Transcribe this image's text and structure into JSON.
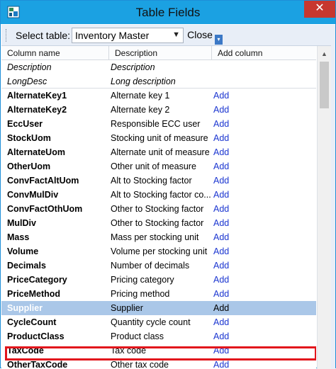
{
  "window": {
    "title": "Table Fields",
    "close_glyph": "✕",
    "app_icon": "table-icon"
  },
  "toolbar": {
    "select_label": "Select table:",
    "table_value": "Inventory Master",
    "close_label": "Close"
  },
  "grid": {
    "headers": [
      "Column name",
      "Description",
      "Add column"
    ],
    "rows": [
      {
        "name": "Description",
        "description": "Description",
        "add": "",
        "style": "italic"
      },
      {
        "name": "LongDesc",
        "description": "Long description",
        "add": "",
        "style": "italic-sep"
      },
      {
        "name": "AlternateKey1",
        "description": "Alternate key 1",
        "add": "Add",
        "style": ""
      },
      {
        "name": "AlternateKey2",
        "description": "Alternate key 2",
        "add": "Add",
        "style": ""
      },
      {
        "name": "EccUser",
        "description": "Responsible ECC user",
        "add": "Add",
        "style": ""
      },
      {
        "name": "StockUom",
        "description": "Stocking unit of measure",
        "add": "Add",
        "style": ""
      },
      {
        "name": "AlternateUom",
        "description": "Alternate unit of measure",
        "add": "Add",
        "style": ""
      },
      {
        "name": "OtherUom",
        "description": "Other unit of measure",
        "add": "Add",
        "style": ""
      },
      {
        "name": "ConvFactAltUom",
        "description": "Alt to Stocking factor",
        "add": "Add",
        "style": ""
      },
      {
        "name": "ConvMulDiv",
        "description": "Alt to Stocking factor co...",
        "add": "Add",
        "style": ""
      },
      {
        "name": "ConvFactOthUom",
        "description": "Other to Stocking factor",
        "add": "Add",
        "style": ""
      },
      {
        "name": "MulDiv",
        "description": "Other to Stocking factor",
        "add": "Add",
        "style": ""
      },
      {
        "name": "Mass",
        "description": "Mass per stocking unit",
        "add": "Add",
        "style": ""
      },
      {
        "name": "Volume",
        "description": "Volume per stocking unit",
        "add": "Add",
        "style": ""
      },
      {
        "name": "Decimals",
        "description": "Number of decimals",
        "add": "Add",
        "style": ""
      },
      {
        "name": "PriceCategory",
        "description": "Pricing category",
        "add": "Add",
        "style": ""
      },
      {
        "name": "PriceMethod",
        "description": "Pricing method",
        "add": "Add",
        "style": ""
      },
      {
        "name": "Supplier",
        "description": "Supplier",
        "add": "Add",
        "style": "selected"
      },
      {
        "name": "CycleCount",
        "description": "Quantity cycle count",
        "add": "Add",
        "style": ""
      },
      {
        "name": "ProductClass",
        "description": "Product class",
        "add": "Add",
        "style": ""
      },
      {
        "name": "TaxCode",
        "description": "Tax code",
        "add": "Add",
        "style": ""
      },
      {
        "name": "OtherTaxCode",
        "description": "Other tax code",
        "add": "Add",
        "style": ""
      }
    ]
  },
  "colors": {
    "titlebar": "#1ba1e2",
    "close_button": "#c7372f",
    "selection": "#aac7e8",
    "highlight_border": "#e2151c",
    "link": "#1a35d0"
  }
}
